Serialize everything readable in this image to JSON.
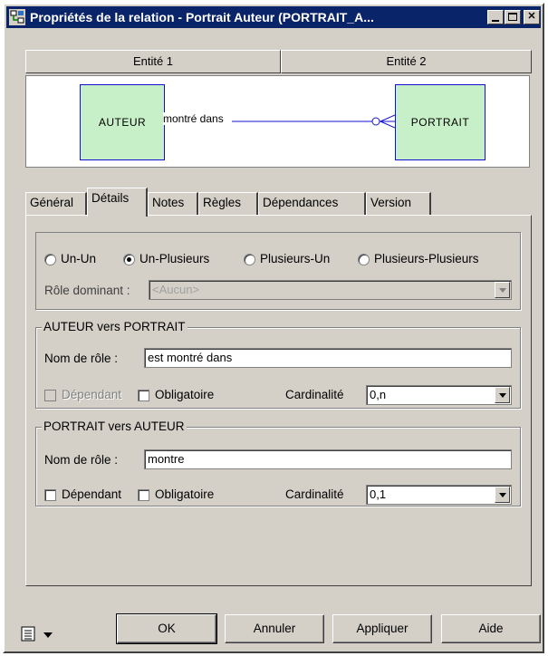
{
  "window": {
    "title": "Propriétés de la relation - Portrait Auteur (PORTRAIT_A...",
    "controls": [
      "minimize",
      "maximize",
      "close"
    ]
  },
  "entity_headers": [
    "Entité 1",
    "Entité 2"
  ],
  "diagram": {
    "entity1": "AUTEUR",
    "entity2": "PORTRAIT",
    "relation_label": "montré dans"
  },
  "tabs": [
    {
      "label": "Général",
      "active": false
    },
    {
      "label": "Détails",
      "active": true
    },
    {
      "label": "Notes",
      "active": false
    },
    {
      "label": "Règles",
      "active": false
    },
    {
      "label": "Dépendances",
      "active": false
    },
    {
      "label": "Version",
      "active": false
    }
  ],
  "cardinality_type": {
    "options": [
      "Un-Un",
      "Un-Plusieurs",
      "Plusieurs-Un",
      "Plusieurs-Plusieurs"
    ],
    "selected": "Un-Plusieurs"
  },
  "dominant_role": {
    "label": "Rôle dominant :",
    "value": "<Aucun>",
    "enabled": false
  },
  "group1": {
    "title": "AUTEUR vers PORTRAIT",
    "role_label": "Nom de rôle :",
    "role_value": "est montré dans",
    "dependant_label": "Dépendant",
    "dependant_checked": false,
    "dependant_enabled": false,
    "mandatory_label": "Obligatoire",
    "mandatory_checked": false,
    "cardinality_label": "Cardinalité",
    "cardinality_value": "0,n"
  },
  "group2": {
    "title": "PORTRAIT vers AUTEUR",
    "role_label": "Nom de rôle :",
    "role_value": "montre",
    "dependant_label": "Dépendant",
    "dependant_checked": false,
    "dependant_enabled": true,
    "mandatory_label": "Obligatoire",
    "mandatory_checked": false,
    "cardinality_label": "Cardinalité",
    "cardinality_value": "0,1"
  },
  "buttons": {
    "ok": "OK",
    "cancel": "Annuler",
    "apply": "Appliquer",
    "help": "Aide"
  },
  "colors": {
    "titlebar": "#0a246a",
    "entity_fill": "#c8f0c8",
    "entity_border": "#1010d0",
    "window_face": "#d4d0c8"
  }
}
